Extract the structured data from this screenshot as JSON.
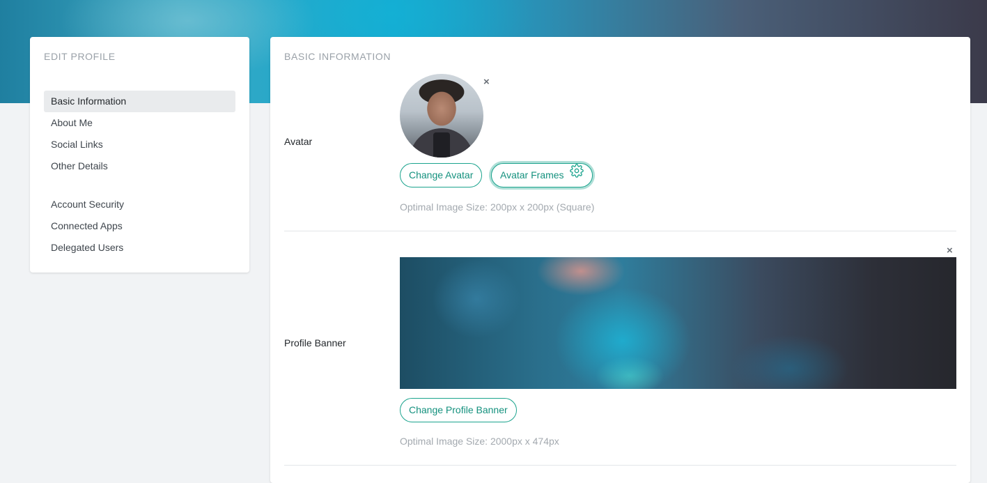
{
  "sidebar": {
    "title": "EDIT PROFILE",
    "group1": [
      {
        "label": "Basic Information",
        "active": true
      },
      {
        "label": "About Me",
        "active": false
      },
      {
        "label": "Social Links",
        "active": false
      },
      {
        "label": "Other Details",
        "active": false
      }
    ],
    "group2": [
      {
        "label": "Account Security",
        "active": false
      },
      {
        "label": "Connected Apps",
        "active": false
      },
      {
        "label": "Delegated Users",
        "active": false
      }
    ]
  },
  "main": {
    "section_title": "BASIC INFORMATION",
    "avatar": {
      "label": "Avatar",
      "remove_icon": "×",
      "change_button": "Change Avatar",
      "frames_button": "Avatar Frames",
      "frames_icon": "gear-icon",
      "hint": "Optimal Image Size: 200px x 200px (Square)"
    },
    "banner": {
      "label": "Profile Banner",
      "remove_icon": "×",
      "change_button": "Change Profile Banner",
      "hint": "Optimal Image Size: 2000px x 474px"
    }
  },
  "colors": {
    "accent": "#1aa38d",
    "active_bg": "#e9ebed",
    "muted_text": "#9aa1a8"
  }
}
